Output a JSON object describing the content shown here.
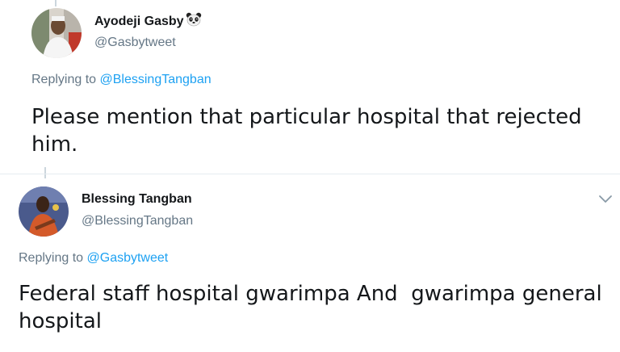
{
  "tweets": [
    {
      "author_name": "Ayodeji Gasby",
      "author_emoji": "panda-face",
      "author_handle": "@Gasbytweet",
      "replying_prefix": "Replying to ",
      "replying_to": "@BlessingTangban",
      "text": "Please mention that particular hospital that rejected him."
    },
    {
      "author_name": "Blessing Tangban",
      "author_handle": "@BlessingTangban",
      "replying_prefix": "Replying to ",
      "replying_to": "@Gasbytweet",
      "text": "Federal staff hospital gwarimpa And  gwarimpa general hospital",
      "menu_icon": "chevron-down-icon"
    }
  ],
  "colors": {
    "link": "#1da1f2",
    "secondary_text": "#657786",
    "primary_text": "#14171a",
    "divider": "#e6ecf0"
  }
}
